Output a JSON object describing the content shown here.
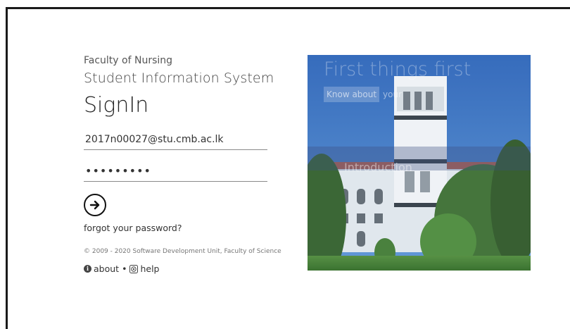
{
  "login": {
    "faculty": "Faculty of Nursing",
    "system": "Student Information System",
    "heading": "SignIn",
    "email_value": "2017n00027@stu.cmb.ac.lk",
    "password_value": "*********",
    "forgot_label": "forgot your password?",
    "copyright": "© 2009 - 2020 Software Development Unit, Faculty of Science",
    "about_label": "about",
    "separator": "•",
    "help_label": "help"
  },
  "hero": {
    "title": "First things first",
    "button_label": "Know about",
    "button_suffix": "your",
    "intro_label": "Introduction"
  },
  "icons": {
    "submit": "arrow-right-circle-icon",
    "about": "info-icon",
    "help": "help-icon"
  },
  "colors": {
    "sky": "#2f6fc4",
    "tower": "#e8edf2",
    "foliage": "#2f5e2a"
  }
}
